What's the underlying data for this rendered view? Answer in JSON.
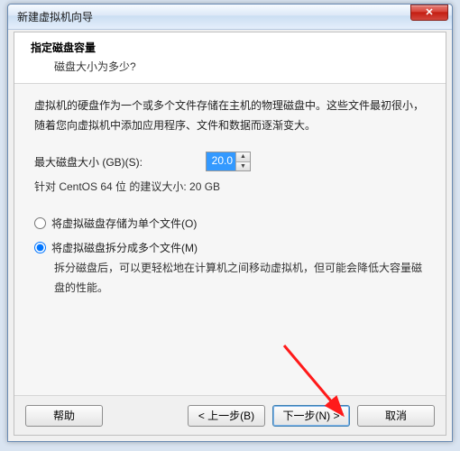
{
  "window": {
    "title": "新建虚拟机向导",
    "close_glyph": "✕"
  },
  "header": {
    "title": "指定磁盘容量",
    "subtitle": "磁盘大小为多少?"
  },
  "body": {
    "description": "虚拟机的硬盘作为一个或多个文件存储在主机的物理磁盘中。这些文件最初很小，随着您向虚拟机中添加应用程序、文件和数据而逐渐变大。",
    "size_label": "最大磁盘大小 (GB)(S):",
    "size_value": "20.0",
    "recommended": "针对 CentOS 64 位 的建议大小: 20 GB",
    "radio_single": "将虚拟磁盘存储为单个文件(O)",
    "radio_split": "将虚拟磁盘拆分成多个文件(M)",
    "split_desc": "拆分磁盘后，可以更轻松地在计算机之间移动虚拟机，但可能会降低大容量磁盘的性能。"
  },
  "footer": {
    "help": "帮助",
    "back": "< 上一步(B)",
    "next": "下一步(N) >",
    "cancel": "取消"
  }
}
